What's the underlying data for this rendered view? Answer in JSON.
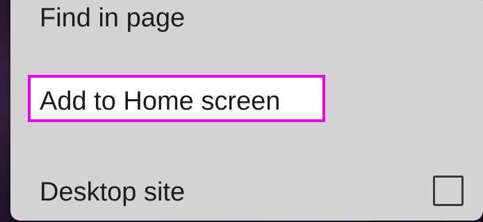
{
  "menu": {
    "items": [
      {
        "label": "Find in page"
      },
      {
        "label": "Add to Home screen",
        "highlighted": true
      },
      {
        "label": "Desktop site",
        "checkbox": {
          "checked": false
        }
      }
    ]
  },
  "colors": {
    "menu_background": "#d3d3d3",
    "highlight_border": "#f000f0",
    "highlight_fill": "#ffffff",
    "text": "#1c1c1c"
  }
}
